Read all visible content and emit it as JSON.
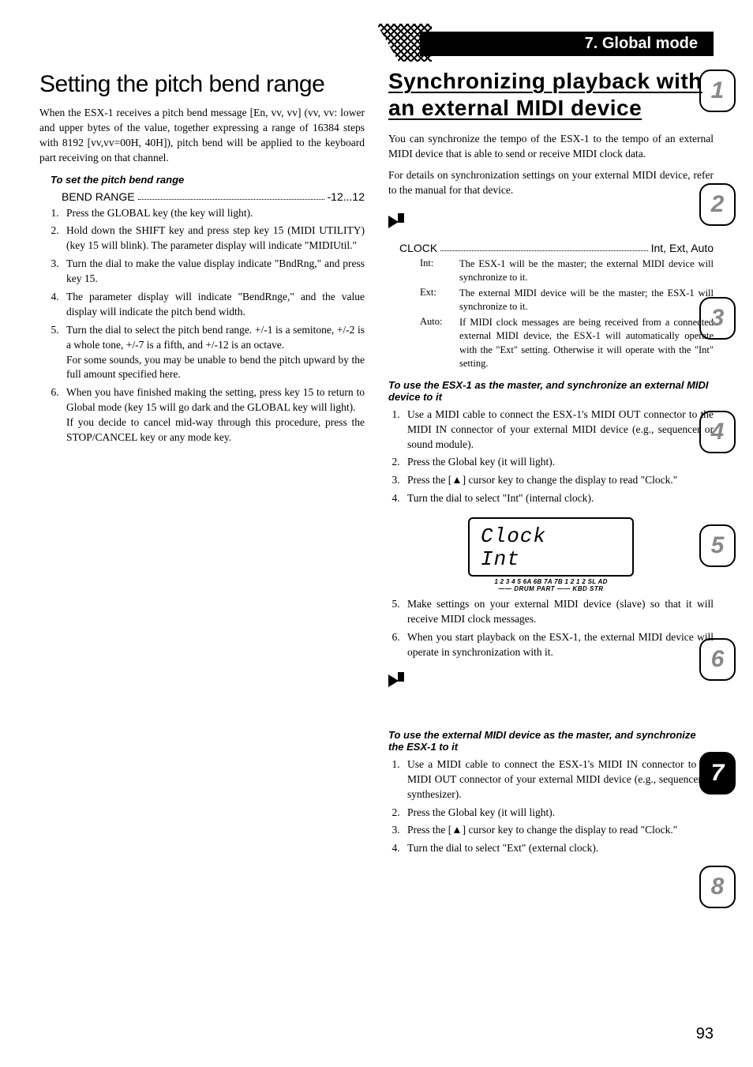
{
  "header": {
    "section": "7. Global mode"
  },
  "left": {
    "title": "Setting the pitch bend range",
    "intro": "When the ESX-1 receives a pitch bend message [En, vv, vv] (vv, vv: lower and upper bytes of the value, together expressing a range of 16384 steps with 8192 [vv,vv=00H, 40H]), pitch bend will be applied to the keyboard part receiving on that channel.",
    "subhead": "To set the pitch bend range",
    "param": {
      "name": "BEND RANGE",
      "value": "-12...12"
    },
    "steps": [
      "Press the GLOBAL key (the key will light).",
      "Hold down the SHIFT key and press step key 15 (MIDI UTILITY) (key 15 will blink). The parameter display will indicate \"MIDIUtil.\"",
      "Turn the dial to make the value display indicate \"BndRng,\" and press key 15.",
      "The parameter display will indicate \"BendRnge,\" and the value display will indicate the pitch bend width.",
      "Turn the dial to select the pitch bend range. +/-1 is a semitone, +/-2 is a whole tone, +/-7 is a fifth, and +/-12 is an octave.",
      "When you have finished making the setting, press key 15 to return to Global mode (key 15 will go dark and the GLOBAL key will light)."
    ],
    "step5_extra": "For some sounds, you may be unable to bend the pitch upward by the full amount specified here.",
    "step6_extra": "If you decide to cancel mid-way through this procedure, press the STOP/CANCEL key or any mode key."
  },
  "right": {
    "title": "Synchronizing playback with an external MIDI device",
    "intro1": "You can synchronize the tempo of the ESX-1 to the tempo of an external MIDI device that is able to send or receive MIDI clock data.",
    "intro2": "For details on synchronization settings on your external MIDI device, refer to the manual for that device.",
    "clock_param": {
      "name": "CLOCK",
      "value": "Int, Ext, Auto"
    },
    "clock_rows": [
      {
        "k": "Int:",
        "d": "The ESX-1 will be the master; the external MIDI device will synchronize to it."
      },
      {
        "k": "Ext:",
        "d": "The external MIDI device will be the master; the ESX-1 will synchronize to it."
      },
      {
        "k": "Auto:",
        "d": "If MIDI clock messages are being received from a connected external MIDI device, the ESX-1 will automatically operate with the \"Ext\" setting. Otherwise it will operate with the \"Int\" setting."
      }
    ],
    "master_subhead": "To use the ESX-1 as the master, and synchronize an external MIDI device to it",
    "master_steps": [
      "Use a MIDI cable to connect the ESX-1's MIDI OUT connector to the MIDI IN connector of your external MIDI device (e.g., sequencer or sound module).",
      "Press the Global key (it will light).",
      "Press the [▲] cursor key to change the display to read \"Clock.\"",
      "Turn the dial to select \"Int\" (internal clock)."
    ],
    "lcd": {
      "line1": "Clock",
      "line2": "Int",
      "scale": "1 2 3 4 5 6A 6B 7A 7B 1 2 1 2 SL AD",
      "sublabel": "—— DRUM PART —— KBD STR"
    },
    "master_steps2": [
      "Make settings on your external MIDI device (slave) so that it will receive MIDI clock messages.",
      "When you start playback on the ESX-1, the external MIDI device will operate in synchronization with it."
    ],
    "slave_subhead": "To use the external MIDI device as the master, and synchronize the ESX-1 to it",
    "slave_steps": [
      "Use a MIDI cable to connect the ESX-1's MIDI IN connector to the MIDI OUT connector of your external MIDI device (e.g., sequencer or synthesizer).",
      "Press the Global key (it will light).",
      "Press the [▲] cursor key to change the display to read \"Clock.\"",
      "Turn the dial to select \"Ext\" (external clock)."
    ]
  },
  "tabs": [
    "1",
    "2",
    "3",
    "4",
    "5",
    "6",
    "7",
    "8"
  ],
  "active_tab_index": 6,
  "page_number": "93"
}
